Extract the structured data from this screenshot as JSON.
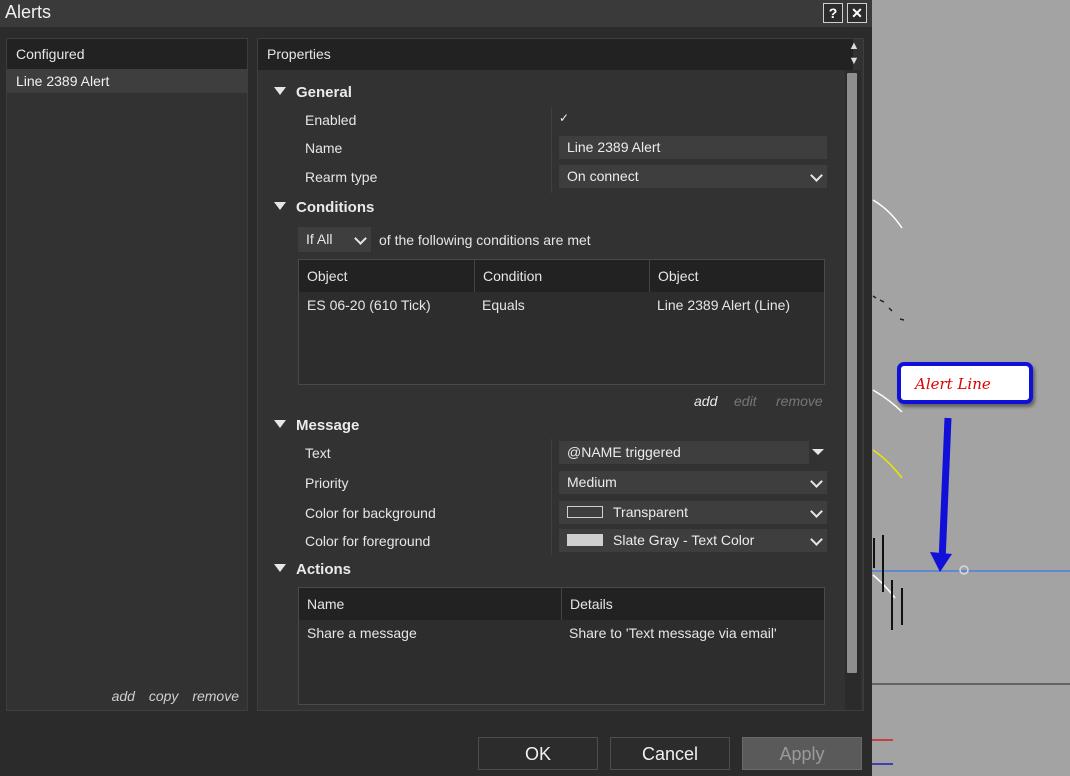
{
  "window": {
    "title": "Alerts",
    "help_label": "?",
    "close_label": "✕"
  },
  "left_panel": {
    "header": "Configured",
    "items": [
      "Line 2389 Alert"
    ],
    "links": {
      "add": "add",
      "copy": "copy",
      "remove": "remove"
    }
  },
  "properties": {
    "header": "Properties",
    "general": {
      "title": "General",
      "enabled_label": "Enabled",
      "enabled_check": "✓",
      "name_label": "Name",
      "name_value": "Line 2389 Alert",
      "rearm_label": "Rearm type",
      "rearm_value": "On connect"
    },
    "conditions": {
      "title": "Conditions",
      "mode_value": "If All",
      "mode_suffix": "of the following conditions are met",
      "columns": [
        "Object",
        "Condition",
        "Object"
      ],
      "rows": [
        [
          "ES 06-20 (610 Tick)",
          "Equals",
          "Line 2389 Alert (Line)"
        ]
      ],
      "links": {
        "add": "add",
        "edit": "edit",
        "remove": "remove"
      }
    },
    "message": {
      "title": "Message",
      "text_label": "Text",
      "text_value": "@NAME triggered",
      "priority_label": "Priority",
      "priority_value": "Medium",
      "bg_label": "Color for background",
      "bg_value": "Transparent",
      "fg_label": "Color for foreground",
      "fg_value": "Slate Gray - Text Color"
    },
    "actions": {
      "title": "Actions",
      "columns": [
        "Name",
        "Details"
      ],
      "rows": [
        [
          "Share a message",
          "Share to 'Text message via email'"
        ]
      ]
    }
  },
  "footer": {
    "ok": "OK",
    "cancel": "Cancel",
    "apply": "Apply"
  },
  "callout": {
    "text": "Alert Line"
  },
  "colors": {
    "fg_swatch": "#d0d0d0",
    "callout_border": "#1010d8",
    "callout_text": "#e00000",
    "alert_line": "#4a7fe0"
  }
}
